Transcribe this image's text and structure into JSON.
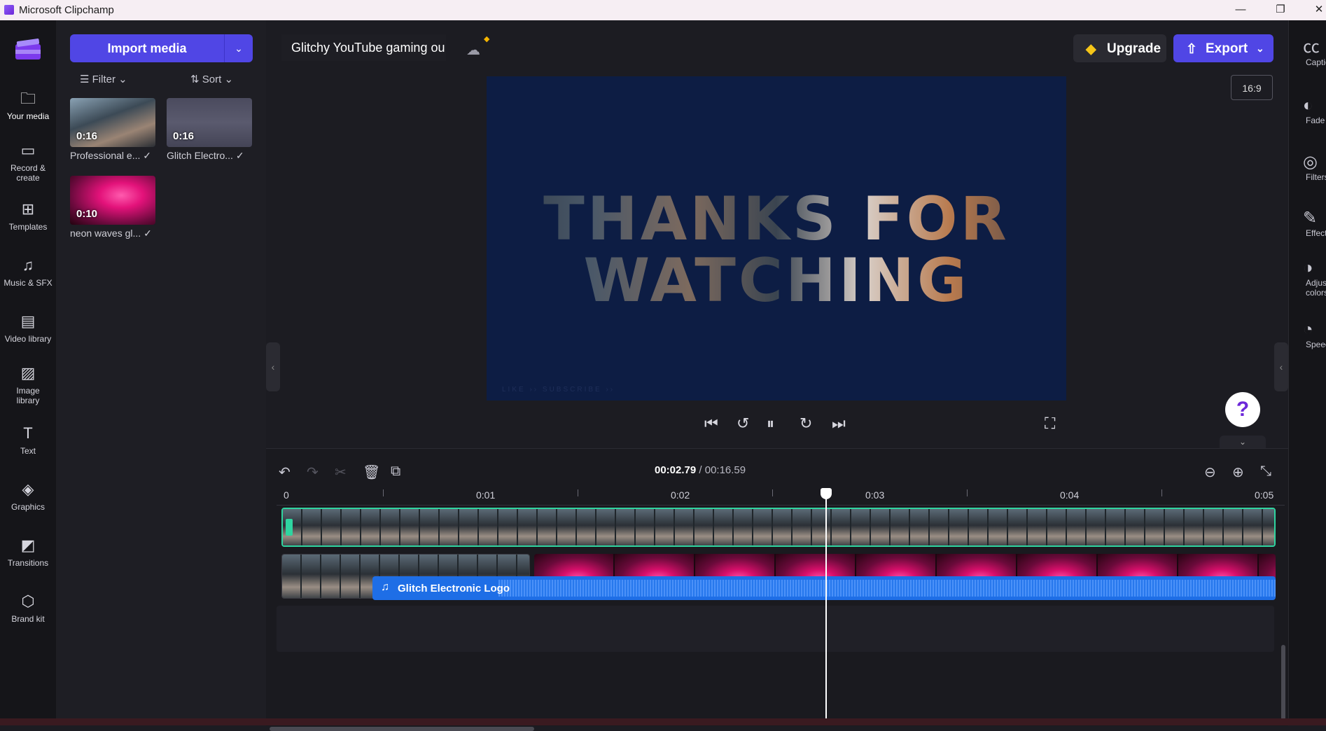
{
  "window": {
    "title": "Microsoft Clipchamp",
    "minimize": "—",
    "restore": "❐",
    "close": "✕"
  },
  "left_rail": {
    "items": [
      {
        "label": "Your media",
        "icon": "folder-icon",
        "glyph": "🗀"
      },
      {
        "label": "Record &\ncreate",
        "icon": "camera-icon",
        "glyph": "▭"
      },
      {
        "label": "Templates",
        "icon": "templates-icon",
        "glyph": "⊞"
      },
      {
        "label": "Music & SFX",
        "icon": "music-icon",
        "glyph": "♫"
      },
      {
        "label": "Video library",
        "icon": "film-icon",
        "glyph": "▤"
      },
      {
        "label": "Image\nlibrary",
        "icon": "image-icon",
        "glyph": "▨"
      },
      {
        "label": "Text",
        "icon": "text-icon",
        "glyph": "T"
      },
      {
        "label": "Graphics",
        "icon": "graphics-icon",
        "glyph": "◈"
      },
      {
        "label": "Transitions",
        "icon": "transitions-icon",
        "glyph": "◩"
      },
      {
        "label": "Brand kit",
        "icon": "brand-kit-icon",
        "glyph": "⬡"
      }
    ]
  },
  "media": {
    "import_label": "Import media",
    "filter_label": "Filter",
    "sort_label": "Sort",
    "items": [
      {
        "duration": "0:16",
        "caption": "Professional e...",
        "check": "✓"
      },
      {
        "duration": "0:16",
        "caption": "Glitch Electro...",
        "check": "✓"
      },
      {
        "duration": "0:10",
        "caption": "neon waves gl...",
        "check": "✓"
      }
    ]
  },
  "header": {
    "project_name": "Glitchy YouTube gaming ou",
    "upgrade_label": "Upgrade",
    "export_label": "Export",
    "aspect_ratio": "16:9"
  },
  "preview": {
    "line1": "THANKS FOR",
    "line2": "WATCHING",
    "faint_text": "LIKE  ››  SUBSCRIBE  ››"
  },
  "player": {
    "skip_back": "⏮",
    "rewind5": "↺",
    "pause": "⏸",
    "forward5": "↻",
    "skip_fwd": "⏭",
    "fullscreen": "⛶",
    "help": "?"
  },
  "timeline": {
    "current_time": "00:02.79",
    "total_time": "/ 00:16.59",
    "ruler_labels": [
      "0",
      "0:01",
      "0:02",
      "0:03",
      "0:04",
      "0:05"
    ],
    "audio_clip_label": "Glitch Electronic Logo",
    "playhead_fraction": 0.168
  },
  "right_rail": {
    "items": [
      {
        "label": "Captions",
        "icon": "captions-icon",
        "glyph": "㏄"
      },
      {
        "label": "Fade",
        "icon": "fade-icon",
        "glyph": "◐"
      },
      {
        "label": "Filters",
        "icon": "filters-icon",
        "glyph": "◎"
      },
      {
        "label": "Effects",
        "icon": "effects-icon",
        "glyph": "✎"
      },
      {
        "label": "Adjust\ncolors",
        "icon": "adjust-colors-icon",
        "glyph": "◑"
      },
      {
        "label": "Speed",
        "icon": "speed-icon",
        "glyph": "◔"
      }
    ]
  },
  "colors": {
    "accent": "#5046e5",
    "audio": "#1e6ee6",
    "preview_bg": "#0d1d44"
  }
}
